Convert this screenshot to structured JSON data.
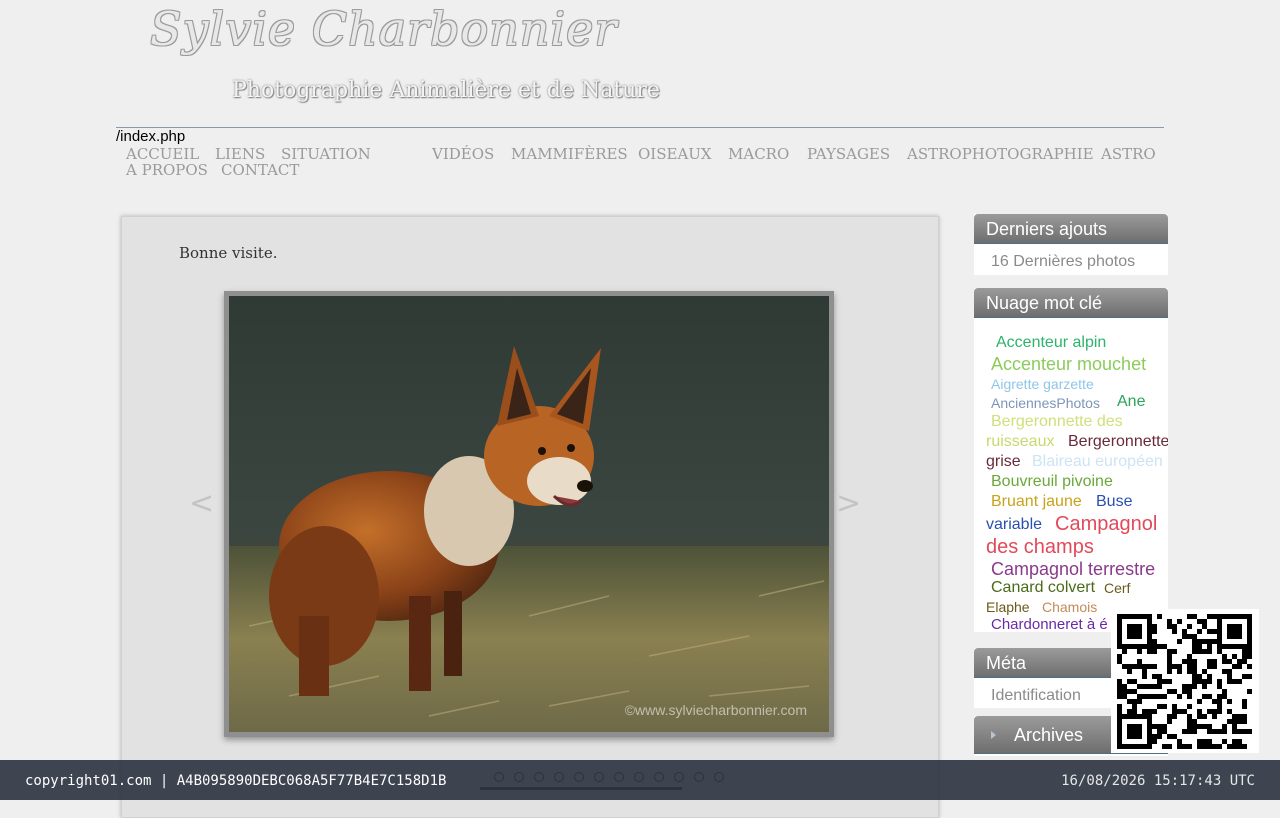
{
  "header": {
    "site_title": "Sylvie Charbonnier",
    "subtitle": "Photographie Animalière et de Nature",
    "path": "/index.php"
  },
  "nav": {
    "row1": [
      "ACCUEIL",
      "LIENS",
      "SITUATION",
      "VIDÉOS",
      "MAMMIFÈRES",
      "OISEAUX",
      "MACRO",
      "PAYSAGES",
      "ASTROPHOTOGRAPHIE",
      "ASTRO"
    ],
    "row2": [
      "A PROPOS",
      "CONTACT"
    ]
  },
  "main": {
    "greeting": "Bonne visite.",
    "slideshow": {
      "watermark": "©www.sylviecharbonnier.com",
      "prev_arrow": "<",
      "next_arrow": ">",
      "dot_count": 12
    }
  },
  "sidebar": {
    "recent": {
      "title": "Derniers ajouts",
      "link": "16 Dernières photos"
    },
    "tags": {
      "title": "Nuage mot clé",
      "items": [
        {
          "text": "Accenteur alpin",
          "color": "#2db36b"
        },
        {
          "text": "Accenteur mouchet",
          "color": "#8ccc5c"
        },
        {
          "text": "Aigrette garzette",
          "color": "#8fc6e8"
        },
        {
          "text": "AnciennesPhotos",
          "color": "#7e95b8"
        },
        {
          "text": "Ane",
          "color": "#2aa35a"
        },
        {
          "text": "Bergeronnette des",
          "color": "#cfe07a"
        },
        {
          "text": "ruisseaux",
          "color": "#c9d86e"
        },
        {
          "text": "Bergeronnette",
          "color": "#6a2a3a"
        },
        {
          "text": "grise",
          "color": "#6a2a3a"
        },
        {
          "text": "Blaireau européen",
          "color": "#cce4f6"
        },
        {
          "text": "Bouvreuil pivoine",
          "color": "#6aa83a"
        },
        {
          "text": "Bruant jaune",
          "color": "#c9a21a"
        },
        {
          "text": "Buse",
          "color": "#2a4fb0"
        },
        {
          "text": "variable",
          "color": "#2a4fb0"
        },
        {
          "text": "Campagnol",
          "color": "#e24a5a"
        },
        {
          "text": "des champs",
          "color": "#e24a5a"
        },
        {
          "text": "Campagnol terrestre",
          "color": "#8a3a8a"
        },
        {
          "text": "Canard colvert",
          "color": "#4a6a1a"
        },
        {
          "text": "Cerf",
          "color": "#6a5a1a"
        },
        {
          "text": "Elaphe",
          "color": "#6a5a1a"
        },
        {
          "text": "Chamois",
          "color": "#c48a5a"
        },
        {
          "text": "Chardonneret à é",
          "color": "#6a2aa8"
        }
      ]
    },
    "meta": {
      "title": "Méta",
      "link": "Identification"
    },
    "archives": {
      "title": "Archives"
    }
  },
  "footer": {
    "left": "copyright01.com  |  A4B095890DEBC068A5F77B4E7C158D1B",
    "right": "16/08/2026 15:17:43 UTC"
  },
  "colors": {
    "page_bg": "#efefef",
    "nav_text": "#9a9a9a",
    "widget_header": "#7a7a7a",
    "footer_bg": "#262c3a"
  },
  "icons": {
    "qr": "qr-code-icon",
    "archives_bullet": "triangle-right-icon"
  }
}
